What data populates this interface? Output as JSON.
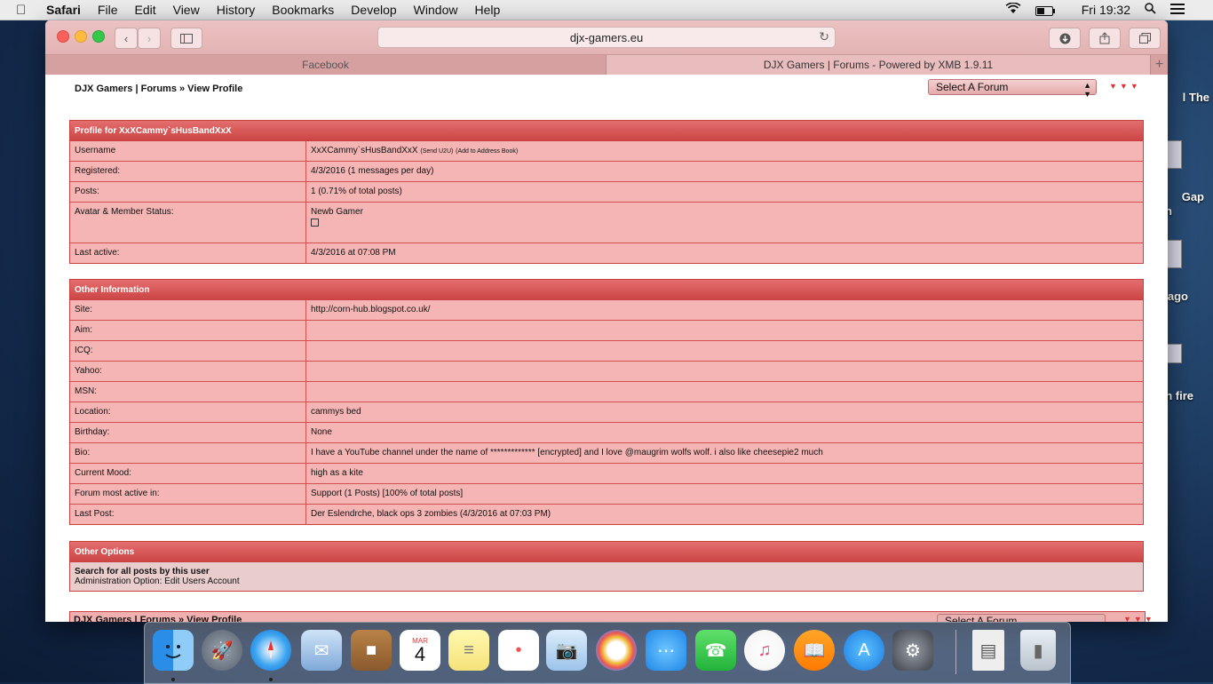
{
  "menubar": {
    "app": "Safari",
    "items": [
      "File",
      "Edit",
      "View",
      "History",
      "Bookmarks",
      "Develop",
      "Window",
      "Help"
    ],
    "clock": "Fri 19:32"
  },
  "desktop": {
    "labels": [
      "l The",
      "Gap",
      "n",
      "ago",
      "n fire"
    ]
  },
  "browser": {
    "address": "djx-gamers.eu",
    "tabs": [
      "Facebook",
      "DJX Gamers | Forums - Powered by XMB 1.9.11"
    ],
    "new_tab_label": "+"
  },
  "page": {
    "breadcrumb": "DJX Gamers | Forums » View Profile",
    "forum_select": "Select A Forum",
    "profile": {
      "header": "Profile for XxXCammy`sHusBandXxX",
      "rows": [
        {
          "key": "Username",
          "value": "XxXCammy`sHusBandXxX",
          "extra1": "(Send U2U)",
          "extra2": "(Add to Address Book)"
        },
        {
          "key": "Registered:",
          "value": "4/3/2016 (1 messages per day)"
        },
        {
          "key": "Posts:",
          "value": "1 (0.71% of total posts)"
        },
        {
          "key": "Avatar & Member Status:",
          "value": "Newb Gamer"
        },
        {
          "key": "Last active:",
          "value": "4/3/2016 at 07:08 PM"
        }
      ]
    },
    "other_info": {
      "header": "Other Information",
      "rows": [
        {
          "key": "Site:",
          "value": "http://corn-hub.blogspot.co.uk/"
        },
        {
          "key": "Aim:",
          "value": ""
        },
        {
          "key": "ICQ:",
          "value": ""
        },
        {
          "key": "Yahoo:",
          "value": ""
        },
        {
          "key": "MSN:",
          "value": ""
        },
        {
          "key": "Location:",
          "value": "cammys bed"
        },
        {
          "key": "Birthday:",
          "value": "None"
        },
        {
          "key": "Bio:",
          "value": "I have a YouTube channel under the name of ************* [encrypted] and I love @maugrim wolfs wolf. i also like cheesepie2 much"
        },
        {
          "key": "Current Mood:",
          "value": "high as a kite"
        },
        {
          "key": "Forum most active in:",
          "value": "Support (1 Posts) [100% of total posts]"
        },
        {
          "key": "Last Post:",
          "value": "Der Eslendrche, black ops 3 zombies (4/3/2016 at 07:03 PM)"
        }
      ]
    },
    "other_options": {
      "header": "Other Options",
      "search_link": "Search for all posts by this user",
      "admin_option": "Administration Option: Edit Users Account"
    }
  },
  "dock": {
    "calendar_month": "MAR",
    "calendar_day": "4",
    "icons": [
      "finder-icon",
      "launchpad-icon",
      "safari-icon",
      "mail-icon",
      "contacts-icon",
      "calendar-icon",
      "notes-icon",
      "reminders-icon",
      "preview-icon",
      "photos-icon",
      "messages-icon",
      "facetime-icon",
      "itunes-icon",
      "ibooks-icon",
      "app-store-icon",
      "system-preferences-icon",
      "document-icon",
      "trash-icon"
    ]
  }
}
